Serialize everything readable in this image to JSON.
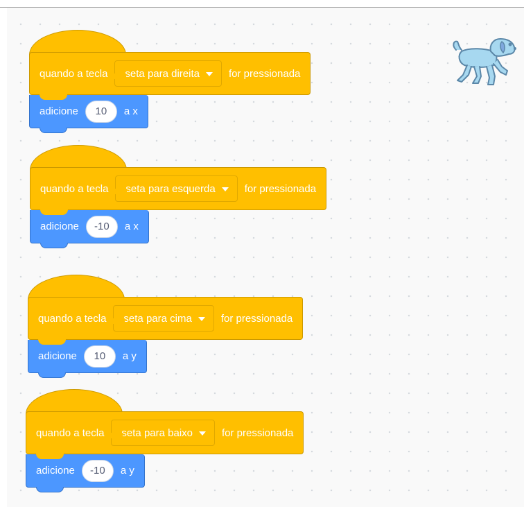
{
  "blocks": [
    {
      "hat": {
        "prefix": "quando a tecla",
        "key": "seta para direita",
        "suffix": "for pressionada"
      },
      "motion": {
        "label": "adicione",
        "value": "10",
        "axis": "a x"
      }
    },
    {
      "hat": {
        "prefix": "quando a tecla",
        "key": "seta para esquerda",
        "suffix": "for pressionada"
      },
      "motion": {
        "label": "adicione",
        "value": "-10",
        "axis": "a x"
      }
    },
    {
      "hat": {
        "prefix": "quando a tecla",
        "key": "seta para cima",
        "suffix": "for pressionada"
      },
      "motion": {
        "label": "adicione",
        "value": "10",
        "axis": "a y"
      }
    },
    {
      "hat": {
        "prefix": "quando a tecla",
        "key": "seta para baixo",
        "suffix": "for pressionada"
      },
      "motion": {
        "label": "adicione",
        "value": "-10",
        "axis": "a y"
      }
    }
  ],
  "colors": {
    "events": "#ffbf00",
    "motion": "#4c97ff",
    "sprite": "#a7d8f0"
  },
  "sprite": {
    "icon": "dog-sprite-icon"
  }
}
